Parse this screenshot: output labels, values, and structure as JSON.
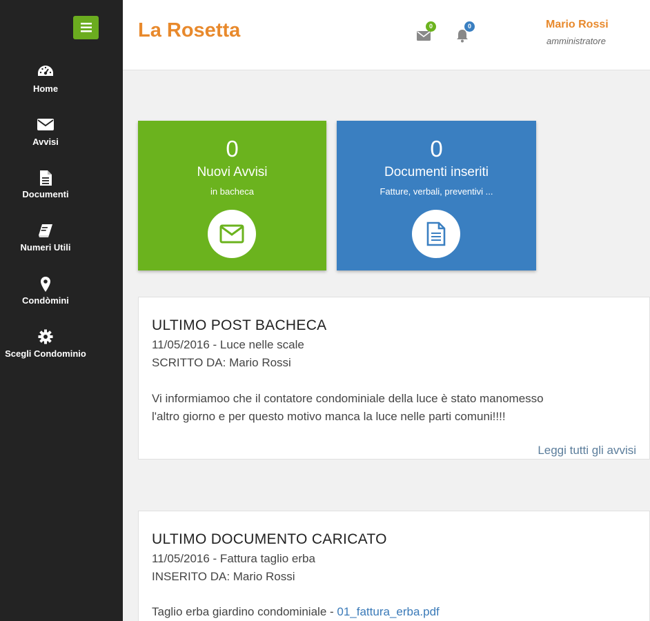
{
  "app": {
    "title": "La Rosetta"
  },
  "sidebar": {
    "items": [
      {
        "label": "Home",
        "icon": "dashboard-icon"
      },
      {
        "label": "Avvisi",
        "icon": "envelope-icon"
      },
      {
        "label": "Documenti",
        "icon": "file-icon"
      },
      {
        "label": "Numeri Utili",
        "icon": "book-icon"
      },
      {
        "label": "Condòmini",
        "icon": "map-marker-icon"
      },
      {
        "label": "Scegli Condominio",
        "icon": "gear-icon"
      }
    ]
  },
  "header": {
    "messages_badge": "0",
    "notifications_badge": "0",
    "user_name": "Mario Rossi",
    "user_role": "amministratore"
  },
  "cards": [
    {
      "value": "0",
      "title": "Nuovi Avvisi",
      "subtitle": "in bacheca",
      "icon": "envelope-icon",
      "color": "#6bb31e"
    },
    {
      "value": "0",
      "title": "Documenti inseriti",
      "subtitle": "Fatture, verbali, preventivi ...",
      "icon": "document-icon",
      "color": "#3a7fc1"
    }
  ],
  "last_post": {
    "heading": "ULTIMO POST BACHECA",
    "date_title": "11/05/2016 - Luce nelle scale",
    "author": "SCRITTO DA: Mario Rossi",
    "body_line1": "Vi informiamoo che il contatore condominiale della luce è stato manomesso",
    "body_line2": "l'altro giorno e per questo motivo manca la luce nelle parti comuni!!!!",
    "read_all": "Leggi tutti gli avvisi"
  },
  "last_document": {
    "heading": "ULTIMO DOCUMENTO CARICATO",
    "date_title": "11/05/2016 - Fattura taglio erba",
    "author": "INSERITO DA: Mario Rossi",
    "description": "Taglio erba giardino condominiale - ",
    "file_link": "01_fattura_erba.pdf"
  },
  "colors": {
    "accent_orange": "#e8892c",
    "sidebar_bg": "#232323",
    "menu_green": "#6bac1f",
    "badge_green": "#6bb31e",
    "badge_blue": "#3a7fc1"
  }
}
